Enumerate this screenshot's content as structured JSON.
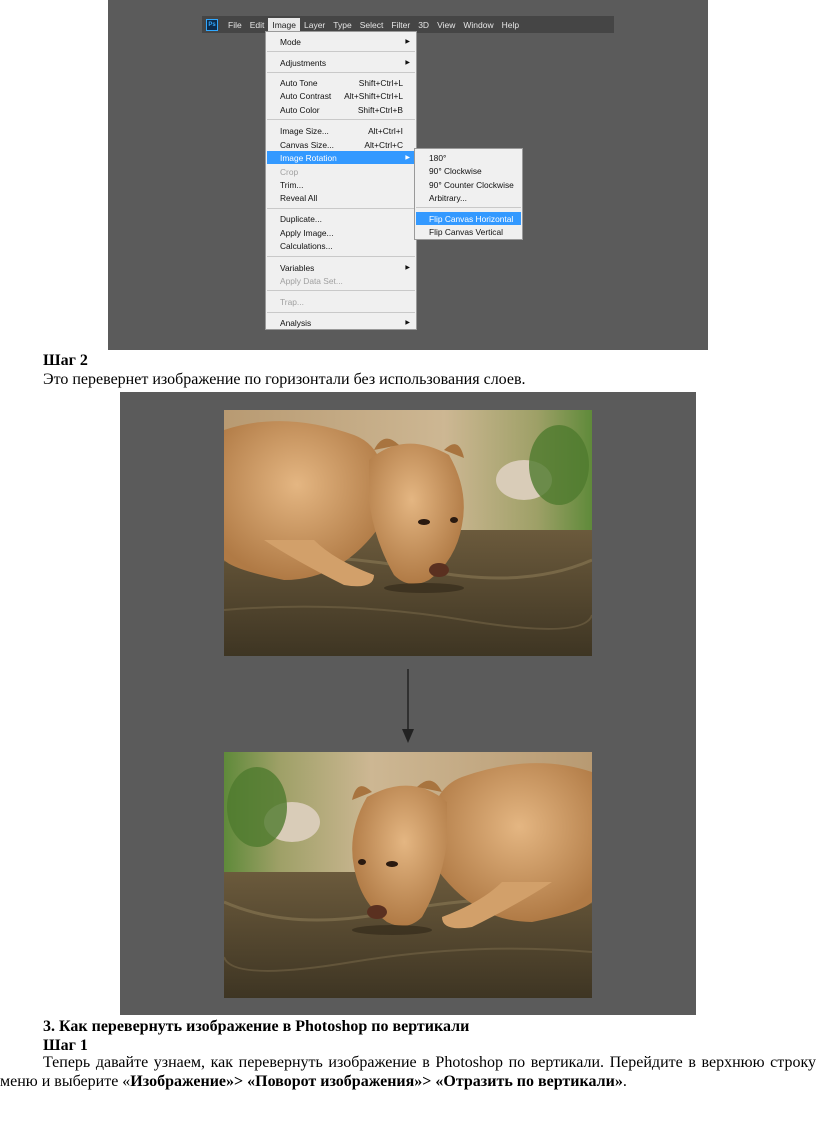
{
  "ps": {
    "logo": "Ps",
    "menubar": [
      "File",
      "Edit",
      "Image",
      "Layer",
      "Type",
      "Select",
      "Filter",
      "3D",
      "View",
      "Window",
      "Help"
    ],
    "active_menu": "Image",
    "image_menu": {
      "mode": "Mode",
      "adjustments": "Adjustments",
      "auto_tone": "Auto Tone",
      "auto_tone_sc": "Shift+Ctrl+L",
      "auto_contrast": "Auto Contrast",
      "auto_contrast_sc": "Alt+Shift+Ctrl+L",
      "auto_color": "Auto Color",
      "auto_color_sc": "Shift+Ctrl+B",
      "image_size": "Image Size...",
      "image_size_sc": "Alt+Ctrl+I",
      "canvas_size": "Canvas Size...",
      "canvas_size_sc": "Alt+Ctrl+C",
      "image_rotation": "Image Rotation",
      "crop": "Crop",
      "trim": "Trim...",
      "reveal_all": "Reveal All",
      "duplicate": "Duplicate...",
      "apply_image": "Apply Image...",
      "calculations": "Calculations...",
      "variables": "Variables",
      "apply_data_set": "Apply Data Set...",
      "trap": "Trap...",
      "analysis": "Analysis"
    },
    "rotation_submenu": {
      "r180": "180°",
      "cw90": "90° Clockwise",
      "ccw90": "90° Counter Clockwise",
      "arbitrary": "Arbitrary...",
      "flip_h": "Flip Canvas Horizontal",
      "flip_v": "Flip Canvas Vertical"
    }
  },
  "doc": {
    "step2_heading": "Шаг 2",
    "step2_text": "Это перевернет изображение по горизонтали без использования слоев.",
    "section3_heading": "3. Как перевернуть изображение в Photoshop по вертикали",
    "step1_heading": "Шаг 1",
    "para_part1": "Теперь давайте узнаем, как перевернуть изображение в Photoshop по вертикали. Перейдите в верхнюю строку меню и выберите «",
    "para_b1": "Изображение»> «Поворот изображения»> «Отразить по вертикали»",
    "para_end": "."
  },
  "colors": {
    "canvas_gray": "#5b5b5b",
    "menubar": "#454545",
    "menu_bg": "#f0f0f0",
    "highlight": "#3399ff"
  }
}
